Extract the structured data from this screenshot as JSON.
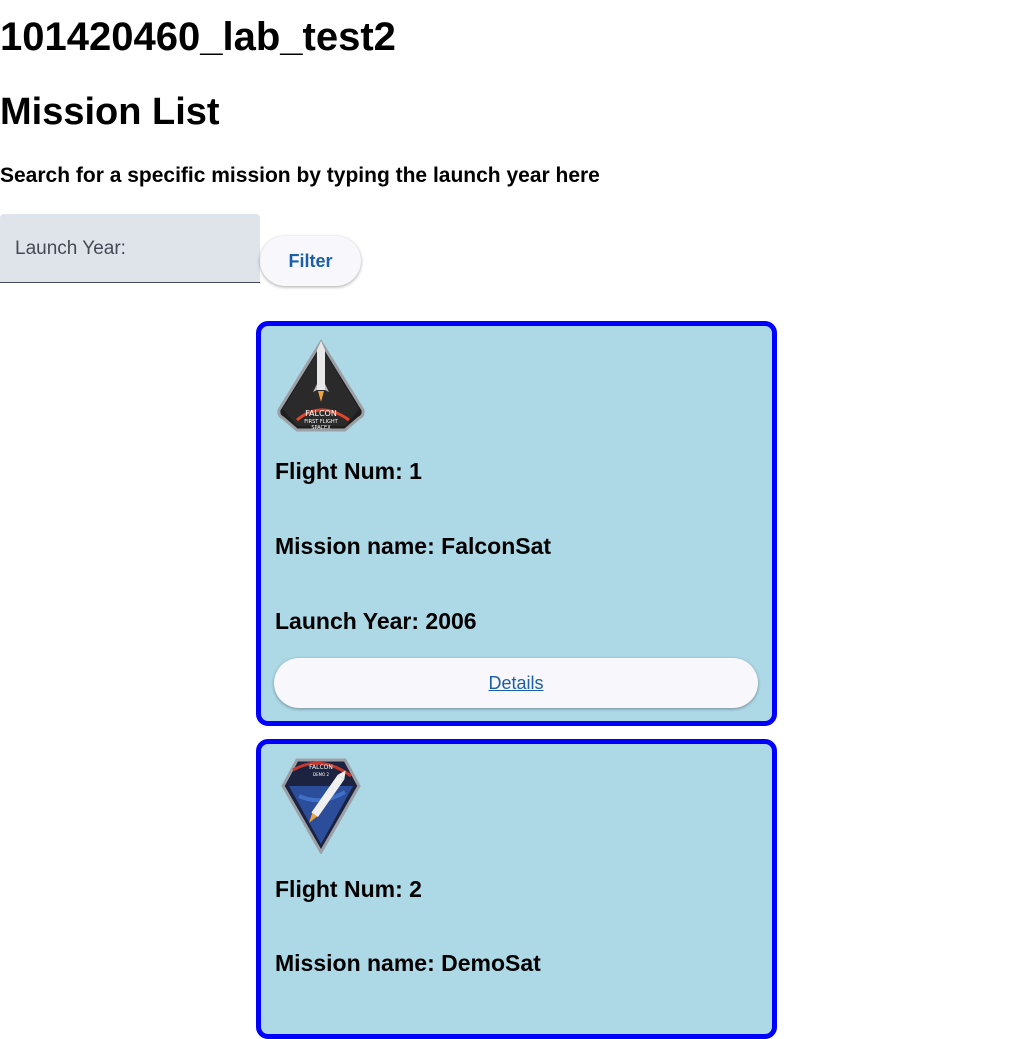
{
  "app": {
    "title": "101420460_lab_test2"
  },
  "page": {
    "heading": "Mission List",
    "search_hint": "Search for a specific mission by typing the launch year here"
  },
  "search": {
    "placeholder": "Launch Year:",
    "value": "",
    "filter_label": "Filter"
  },
  "missions": [
    {
      "flight_number": "Flight Num: 1",
      "mission_name": "Mission name: FalconSat",
      "launch_year": "Launch Year: 2006",
      "details_label": "Details",
      "patch_icon": "falcon-1-first-flight-patch-icon",
      "patch_text": [
        "FALCON",
        "FIRST FLIGHT",
        "SPACEX"
      ]
    },
    {
      "flight_number": "Flight Num: 2",
      "mission_name": "Mission name: DemoSat",
      "patch_icon": "falcon-demo-2-patch-icon",
      "patch_text": [
        "FALCON",
        "DEMO 2"
      ]
    }
  ],
  "colors": {
    "card_background": "#add8e6",
    "card_border": "#0000ff",
    "button_text": "#1a5fa8",
    "input_background": "#dfe3ea"
  }
}
